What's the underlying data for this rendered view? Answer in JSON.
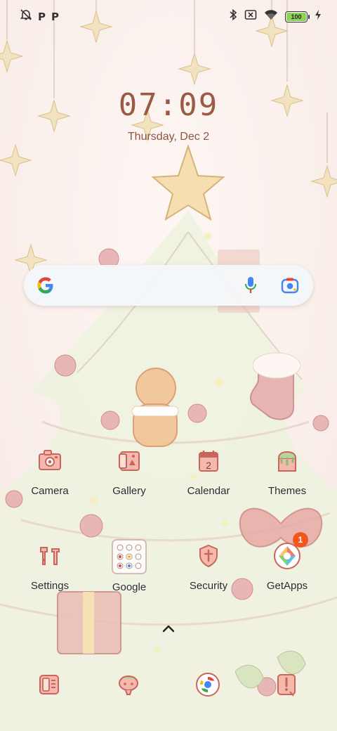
{
  "status_bar": {
    "left_icons": [
      "alarm-off-icon",
      "p-notification-icon",
      "p-notification-icon"
    ],
    "p_letter": "P",
    "right_icons": [
      "bluetooth-icon",
      "sim-off-icon",
      "wifi-icon",
      "battery-icon",
      "charging-icon"
    ],
    "battery_level": "100",
    "battery_fill_percent": 100
  },
  "clock": {
    "time": "07:09",
    "date": "Thursday, Dec 2"
  },
  "search_bar": {
    "icons": [
      "google-logo-icon",
      "microphone-icon",
      "google-lens-icon"
    ]
  },
  "apps": {
    "row1": [
      {
        "label": "Camera",
        "icon": "camera-icon"
      },
      {
        "label": "Gallery",
        "icon": "gallery-icon"
      },
      {
        "label": "Calendar",
        "icon": "calendar-icon",
        "icon_text": "2"
      },
      {
        "label": "Themes",
        "icon": "themes-icon"
      }
    ],
    "row2": [
      {
        "label": "Settings",
        "icon": "settings-icon"
      },
      {
        "label": "Google",
        "icon": "google-folder-icon"
      },
      {
        "label": "Security",
        "icon": "security-icon"
      },
      {
        "label": "GetApps",
        "icon": "getapps-icon",
        "badge": "1"
      }
    ]
  },
  "app_drawer": {
    "icon": "chevron-up-icon"
  },
  "dock": [
    "phone-icon",
    "messages-icon",
    "chrome-icon",
    "notes-icon"
  ],
  "colors": {
    "clock": "#9a5a43",
    "icon_red": "#c9665c",
    "icon_fill": "#f4b9ad",
    "badge": "#f2571e"
  }
}
